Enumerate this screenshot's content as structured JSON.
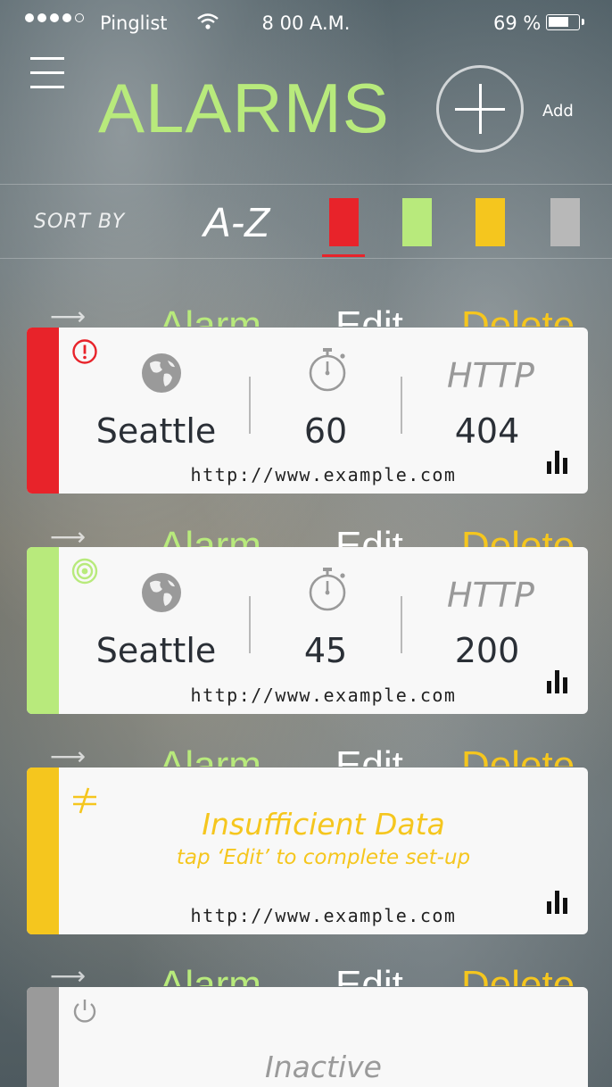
{
  "status_bar": {
    "carrier": "Pinglist",
    "time": "8 00 A.M.",
    "battery": "69 %"
  },
  "header": {
    "title": "ALARMS",
    "add_label": "Add"
  },
  "sort": {
    "label": "SORT BY",
    "az": "A-Z",
    "colors": [
      "#e8232a",
      "#b8ea7c",
      "#f5c61e",
      "#b8b8b8"
    ],
    "selected": 0
  },
  "swipe_actions": {
    "alarm": "Alarm",
    "edit": "Edit",
    "delete": "Delete",
    "alarm_color": "#b8ea7c",
    "edit_color": "#ffffff",
    "delete_color": "#f5c61e"
  },
  "alarms": [
    {
      "status": "error",
      "color": "#e8232a",
      "location": "Seattle",
      "interval": "60",
      "http_label": "HTTP",
      "http_code": "404",
      "url": "http://www.example.com"
    },
    {
      "status": "ok",
      "color": "#b8ea7c",
      "location": "Seattle",
      "interval": "45",
      "http_label": "HTTP",
      "http_code": "200",
      "url": "http://www.example.com"
    },
    {
      "status": "insufficient",
      "color": "#f5c61e",
      "message": "Insufficient Data",
      "hint": "tap ‘Edit’ to complete set-up",
      "url": "http://www.example.com"
    },
    {
      "status": "inactive",
      "color": "#9a9a9a",
      "message": "Inactive"
    }
  ]
}
